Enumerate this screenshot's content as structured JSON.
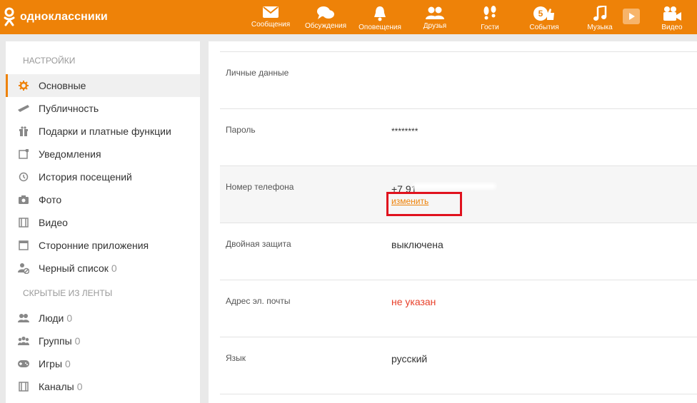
{
  "brand": {
    "name": "одноклассники"
  },
  "nav": [
    {
      "label": "Сообщения",
      "icon": "envelope-icon"
    },
    {
      "label": "Обсуждения",
      "icon": "chat-bubbles-icon"
    },
    {
      "label": "Оповещения",
      "icon": "bell-icon"
    },
    {
      "label": "Друзья",
      "icon": "friends-icon"
    },
    {
      "label": "Гости",
      "icon": "footprints-icon"
    },
    {
      "label": "События",
      "icon": "events-icon",
      "badge": "5"
    },
    {
      "label": "Музыка",
      "icon": "music-note-icon"
    },
    {
      "label": "",
      "icon": "video-play-icon"
    },
    {
      "label": "Видео",
      "icon": "video-camera-icon"
    }
  ],
  "sidebar": {
    "section_settings": "НАСТРОЙКИ",
    "items": [
      {
        "label": "Основные",
        "icon": "gear-icon",
        "active": true
      },
      {
        "label": "Публичность",
        "icon": "megaphone-icon"
      },
      {
        "label": "Подарки и платные функции",
        "icon": "gift-icon"
      },
      {
        "label": "Уведомления",
        "icon": "notification-icon"
      },
      {
        "label": "История посещений",
        "icon": "history-icon"
      },
      {
        "label": "Фото",
        "icon": "camera-icon"
      },
      {
        "label": "Видео",
        "icon": "film-icon"
      },
      {
        "label": "Сторонние приложения",
        "icon": "window-icon"
      },
      {
        "label": "Черный список",
        "icon": "blocked-user-icon",
        "count": "0"
      }
    ],
    "section_hidden": "СКРЫТЫЕ ИЗ ЛЕНТЫ",
    "hidden_items": [
      {
        "label": "Люди",
        "icon": "people-icon",
        "count": "0"
      },
      {
        "label": "Группы",
        "icon": "groups-icon",
        "count": "0"
      },
      {
        "label": "Игры",
        "icon": "gamepad-icon",
        "count": "0"
      },
      {
        "label": "Каналы",
        "icon": "channels-icon",
        "count": "0"
      }
    ]
  },
  "settings": {
    "personal_label": "Личные данные",
    "password_label": "Пароль",
    "password_value": "********",
    "phone_label": "Номер телефона",
    "phone_value": "+7 91",
    "phone_change": "изменить",
    "twofa_label": "Двойная защита",
    "twofa_value": "выключена",
    "email_label": "Адрес эл. почты",
    "email_value": "не указан",
    "lang_label": "Язык",
    "lang_value": "русский"
  },
  "colors": {
    "brand": "#ee8208",
    "highlight_box": "#e0121e",
    "warning_text": "#e8402a"
  }
}
